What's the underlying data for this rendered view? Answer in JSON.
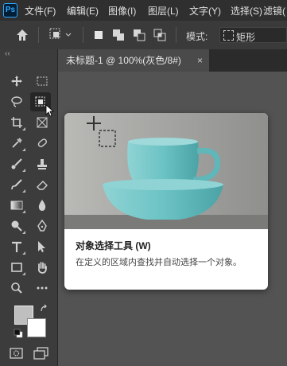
{
  "app": {
    "logo_text": "Ps"
  },
  "menu": [
    "文件(F)",
    "编辑(E)",
    "图像(I)",
    "图层(L)",
    "文字(Y)",
    "选择(S)",
    "滤镜("
  ],
  "options_bar": {
    "mode_label": "模式:",
    "mode_value": "矩形"
  },
  "toolbar": {
    "collapse_glyph": "‹‹"
  },
  "document_tab": {
    "title": "未标题-1 @ 100%(灰色/8#)",
    "close_glyph": "×"
  },
  "tooltip": {
    "title": "对象选择工具 (W)",
    "description": "在定义的区域内查找并自动选择一个对象。"
  },
  "colors": {
    "foreground": "#bfbfbf",
    "background": "#ffffff",
    "accent": "#31a8ff",
    "cup": "#6fc5c6"
  }
}
